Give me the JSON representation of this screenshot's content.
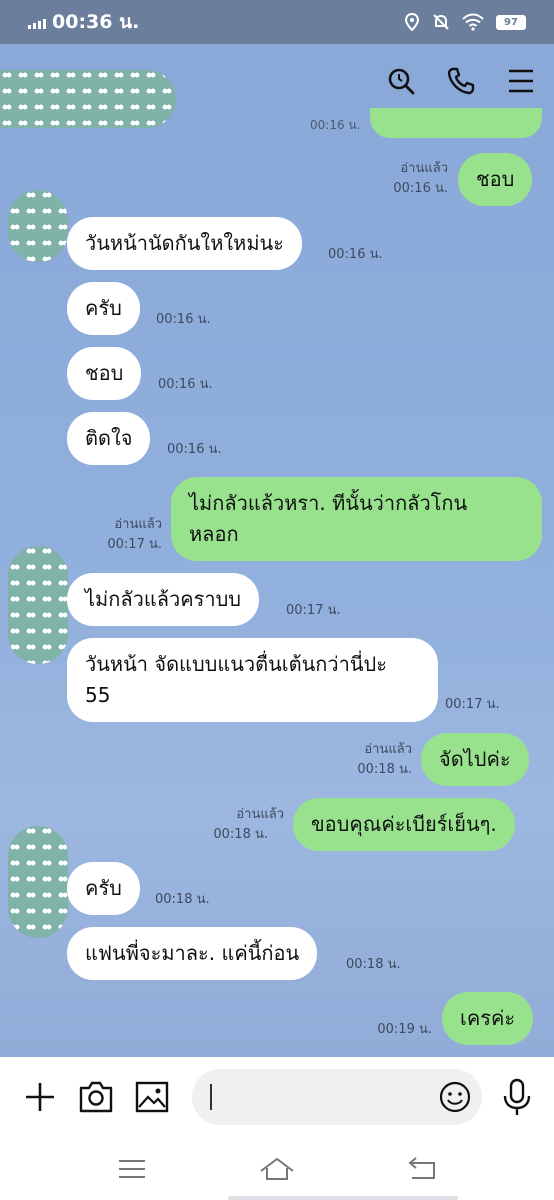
{
  "status_bar": {
    "time": "00:36 น.",
    "battery": "97",
    "icons": [
      "signal-icon",
      "location-icon",
      "mute-bell-icon",
      "wifi-icon",
      "battery-icon"
    ]
  },
  "header": {
    "icons": [
      "search-icon",
      "phone-icon",
      "menu-icon"
    ],
    "partial_time": "00:16 น."
  },
  "messages": [
    {
      "dir": "out",
      "text": "ชอบ",
      "read": "อ่านแล้ว",
      "time": "00:16 น."
    },
    {
      "dir": "in",
      "text": "วันหน้านัดกันใหใหม่นะ",
      "time": "00:16 น."
    },
    {
      "dir": "in",
      "text": "ครับ",
      "time": "00:16 น."
    },
    {
      "dir": "in",
      "text": "ชอบ",
      "time": "00:16 น."
    },
    {
      "dir": "in",
      "text": "ติดใจ",
      "time": "00:16 น."
    },
    {
      "dir": "out",
      "text_line1": "ไม่กลัวแล้วหรา. ทีนั้นว่ากลัวโกน",
      "text_line2": "หลอก",
      "read": "อ่านแล้ว",
      "time": "00:17 น."
    },
    {
      "dir": "in",
      "text": "ไม่กลัวแล้วคราบบ",
      "time": "00:17 น."
    },
    {
      "dir": "in",
      "text_line1": "วันหน้า จัดแบบแนวตื่นเต้นกว่านี่ปะ",
      "text_line2": "55",
      "time": "00:17 น."
    },
    {
      "dir": "out",
      "text": "จัดไปค่ะ",
      "read": "อ่านแล้ว",
      "time": "00:18 น."
    },
    {
      "dir": "out",
      "text": "ขอบคุณค่ะเบียร์เย็นๆ.",
      "read": "อ่านแล้ว",
      "time": "00:18 น."
    },
    {
      "dir": "in",
      "text": "ครับ",
      "time": "00:18 น."
    },
    {
      "dir": "in",
      "text": "แฟนพี่จะมาละ. แค่นี้ก่อน",
      "time": "00:18 น."
    },
    {
      "dir": "out",
      "text": "เครค่ะ",
      "time": "00:19 น."
    }
  ],
  "input_bar": {
    "value": "",
    "icons": [
      "plus-icon",
      "camera-icon",
      "image-icon",
      "emoji-icon",
      "mic-icon"
    ]
  },
  "nav_bar": {
    "icons": [
      "recent-apps-icon",
      "home-icon",
      "back-icon"
    ]
  },
  "colors": {
    "chat_background": "#8facd9",
    "outgoing_bubble": "#98e28e",
    "incoming_bubble": "#ffffff",
    "status_bar": "#6b7f9c"
  }
}
